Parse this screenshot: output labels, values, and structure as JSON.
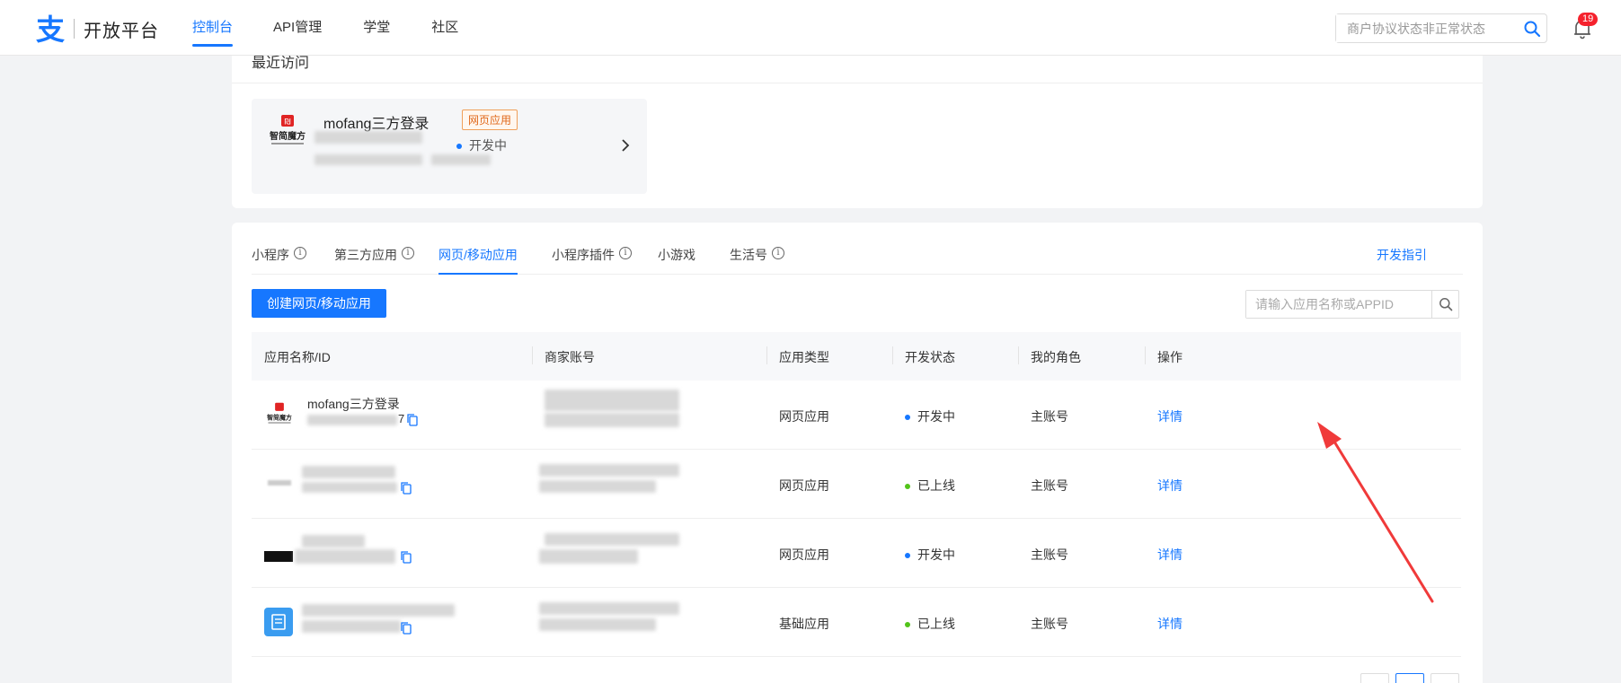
{
  "header": {
    "logo_text": "开放平台",
    "nav": [
      "控制台",
      "API管理",
      "学堂",
      "社区"
    ],
    "search_placeholder": "商户协议状态非正常状态",
    "notification_count": "19"
  },
  "recent": {
    "title": "最近访问",
    "app_name": "mofang三方登录",
    "app_tag": "网页应用",
    "app_status": "开发中",
    "logo_text": "智简魔方"
  },
  "apps": {
    "tabs": [
      "小程序",
      "第三方应用",
      "网页/移动应用",
      "小程序插件",
      "小游戏",
      "生活号"
    ],
    "guide_link": "开发指引",
    "create_button": "创建网页/移动应用",
    "search_placeholder": "请输入应用名称或APPID",
    "columns": [
      "应用名称/ID",
      "商家账号",
      "应用类型",
      "开发状态",
      "我的角色",
      "操作"
    ],
    "rows": [
      {
        "name": "mofang三方登录",
        "id_suffix": "7",
        "type": "网页应用",
        "status": "开发中",
        "status_color": "#1677ff",
        "role": "主账号",
        "action": "详情"
      },
      {
        "name": "",
        "id_suffix": "",
        "type": "网页应用",
        "status": "已上线",
        "status_color": "#52c41a",
        "role": "主账号",
        "action": "详情"
      },
      {
        "name": "",
        "id_suffix": "",
        "type": "网页应用",
        "status": "开发中",
        "status_color": "#1677ff",
        "role": "主账号",
        "action": "详情"
      },
      {
        "name": "",
        "id_suffix": "",
        "type": "基础应用",
        "status": "已上线",
        "status_color": "#52c41a",
        "role": "主账号",
        "action": "详情"
      }
    ]
  },
  "colors": {
    "accent": "#1677ff",
    "annotation_arrow": "#f03a3a"
  }
}
